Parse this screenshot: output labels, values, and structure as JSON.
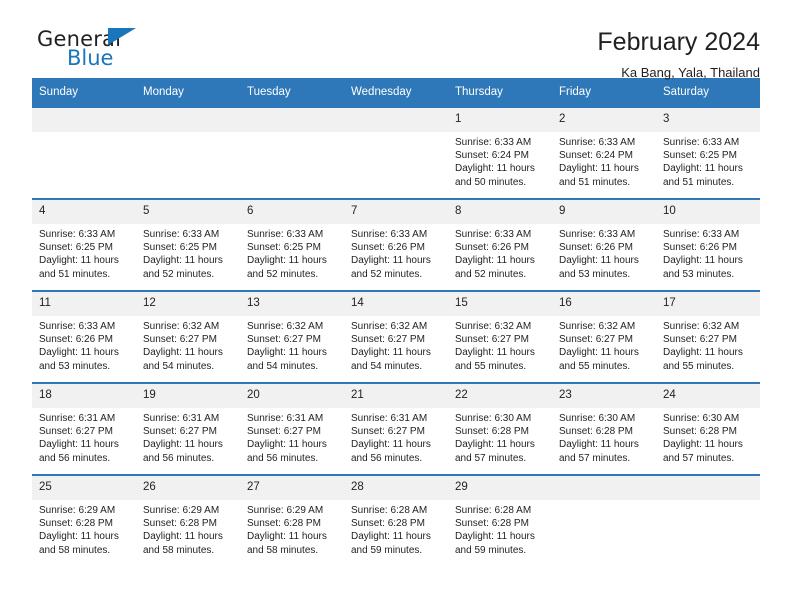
{
  "brand": {
    "name_top": "General",
    "name_bottom": "Blue",
    "accent_color": "#1b75bb"
  },
  "header": {
    "title": "February 2024",
    "subtitle": "Ka Bang, Yala, Thailand"
  },
  "theme": {
    "header_blue": "#2e78b9",
    "daynum_bg": "#f1f1f1",
    "text": "#231f20"
  },
  "weekdays": [
    "Sunday",
    "Monday",
    "Tuesday",
    "Wednesday",
    "Thursday",
    "Friday",
    "Saturday"
  ],
  "labels": {
    "sunrise_prefix": "Sunrise:",
    "sunset_prefix": "Sunset:",
    "daylight_prefix": "Daylight:"
  },
  "weeks": [
    [
      {
        "day": "",
        "empty": true
      },
      {
        "day": "",
        "empty": true
      },
      {
        "day": "",
        "empty": true
      },
      {
        "day": "",
        "empty": true
      },
      {
        "day": "1",
        "sunrise": "Sunrise: 6:33 AM",
        "sunset": "Sunset: 6:24 PM",
        "daylight1": "Daylight: 11 hours",
        "daylight2": "and 50 minutes."
      },
      {
        "day": "2",
        "sunrise": "Sunrise: 6:33 AM",
        "sunset": "Sunset: 6:24 PM",
        "daylight1": "Daylight: 11 hours",
        "daylight2": "and 51 minutes."
      },
      {
        "day": "3",
        "sunrise": "Sunrise: 6:33 AM",
        "sunset": "Sunset: 6:25 PM",
        "daylight1": "Daylight: 11 hours",
        "daylight2": "and 51 minutes."
      }
    ],
    [
      {
        "day": "4",
        "sunrise": "Sunrise: 6:33 AM",
        "sunset": "Sunset: 6:25 PM",
        "daylight1": "Daylight: 11 hours",
        "daylight2": "and 51 minutes."
      },
      {
        "day": "5",
        "sunrise": "Sunrise: 6:33 AM",
        "sunset": "Sunset: 6:25 PM",
        "daylight1": "Daylight: 11 hours",
        "daylight2": "and 52 minutes."
      },
      {
        "day": "6",
        "sunrise": "Sunrise: 6:33 AM",
        "sunset": "Sunset: 6:25 PM",
        "daylight1": "Daylight: 11 hours",
        "daylight2": "and 52 minutes."
      },
      {
        "day": "7",
        "sunrise": "Sunrise: 6:33 AM",
        "sunset": "Sunset: 6:26 PM",
        "daylight1": "Daylight: 11 hours",
        "daylight2": "and 52 minutes."
      },
      {
        "day": "8",
        "sunrise": "Sunrise: 6:33 AM",
        "sunset": "Sunset: 6:26 PM",
        "daylight1": "Daylight: 11 hours",
        "daylight2": "and 52 minutes."
      },
      {
        "day": "9",
        "sunrise": "Sunrise: 6:33 AM",
        "sunset": "Sunset: 6:26 PM",
        "daylight1": "Daylight: 11 hours",
        "daylight2": "and 53 minutes."
      },
      {
        "day": "10",
        "sunrise": "Sunrise: 6:33 AM",
        "sunset": "Sunset: 6:26 PM",
        "daylight1": "Daylight: 11 hours",
        "daylight2": "and 53 minutes."
      }
    ],
    [
      {
        "day": "11",
        "sunrise": "Sunrise: 6:33 AM",
        "sunset": "Sunset: 6:26 PM",
        "daylight1": "Daylight: 11 hours",
        "daylight2": "and 53 minutes."
      },
      {
        "day": "12",
        "sunrise": "Sunrise: 6:32 AM",
        "sunset": "Sunset: 6:27 PM",
        "daylight1": "Daylight: 11 hours",
        "daylight2": "and 54 minutes."
      },
      {
        "day": "13",
        "sunrise": "Sunrise: 6:32 AM",
        "sunset": "Sunset: 6:27 PM",
        "daylight1": "Daylight: 11 hours",
        "daylight2": "and 54 minutes."
      },
      {
        "day": "14",
        "sunrise": "Sunrise: 6:32 AM",
        "sunset": "Sunset: 6:27 PM",
        "daylight1": "Daylight: 11 hours",
        "daylight2": "and 54 minutes."
      },
      {
        "day": "15",
        "sunrise": "Sunrise: 6:32 AM",
        "sunset": "Sunset: 6:27 PM",
        "daylight1": "Daylight: 11 hours",
        "daylight2": "and 55 minutes."
      },
      {
        "day": "16",
        "sunrise": "Sunrise: 6:32 AM",
        "sunset": "Sunset: 6:27 PM",
        "daylight1": "Daylight: 11 hours",
        "daylight2": "and 55 minutes."
      },
      {
        "day": "17",
        "sunrise": "Sunrise: 6:32 AM",
        "sunset": "Sunset: 6:27 PM",
        "daylight1": "Daylight: 11 hours",
        "daylight2": "and 55 minutes."
      }
    ],
    [
      {
        "day": "18",
        "sunrise": "Sunrise: 6:31 AM",
        "sunset": "Sunset: 6:27 PM",
        "daylight1": "Daylight: 11 hours",
        "daylight2": "and 56 minutes."
      },
      {
        "day": "19",
        "sunrise": "Sunrise: 6:31 AM",
        "sunset": "Sunset: 6:27 PM",
        "daylight1": "Daylight: 11 hours",
        "daylight2": "and 56 minutes."
      },
      {
        "day": "20",
        "sunrise": "Sunrise: 6:31 AM",
        "sunset": "Sunset: 6:27 PM",
        "daylight1": "Daylight: 11 hours",
        "daylight2": "and 56 minutes."
      },
      {
        "day": "21",
        "sunrise": "Sunrise: 6:31 AM",
        "sunset": "Sunset: 6:27 PM",
        "daylight1": "Daylight: 11 hours",
        "daylight2": "and 56 minutes."
      },
      {
        "day": "22",
        "sunrise": "Sunrise: 6:30 AM",
        "sunset": "Sunset: 6:28 PM",
        "daylight1": "Daylight: 11 hours",
        "daylight2": "and 57 minutes."
      },
      {
        "day": "23",
        "sunrise": "Sunrise: 6:30 AM",
        "sunset": "Sunset: 6:28 PM",
        "daylight1": "Daylight: 11 hours",
        "daylight2": "and 57 minutes."
      },
      {
        "day": "24",
        "sunrise": "Sunrise: 6:30 AM",
        "sunset": "Sunset: 6:28 PM",
        "daylight1": "Daylight: 11 hours",
        "daylight2": "and 57 minutes."
      }
    ],
    [
      {
        "day": "25",
        "sunrise": "Sunrise: 6:29 AM",
        "sunset": "Sunset: 6:28 PM",
        "daylight1": "Daylight: 11 hours",
        "daylight2": "and 58 minutes."
      },
      {
        "day": "26",
        "sunrise": "Sunrise: 6:29 AM",
        "sunset": "Sunset: 6:28 PM",
        "daylight1": "Daylight: 11 hours",
        "daylight2": "and 58 minutes."
      },
      {
        "day": "27",
        "sunrise": "Sunrise: 6:29 AM",
        "sunset": "Sunset: 6:28 PM",
        "daylight1": "Daylight: 11 hours",
        "daylight2": "and 58 minutes."
      },
      {
        "day": "28",
        "sunrise": "Sunrise: 6:28 AM",
        "sunset": "Sunset: 6:28 PM",
        "daylight1": "Daylight: 11 hours",
        "daylight2": "and 59 minutes."
      },
      {
        "day": "29",
        "sunrise": "Sunrise: 6:28 AM",
        "sunset": "Sunset: 6:28 PM",
        "daylight1": "Daylight: 11 hours",
        "daylight2": "and 59 minutes."
      },
      {
        "day": "",
        "empty": true
      },
      {
        "day": "",
        "empty": true
      }
    ]
  ]
}
